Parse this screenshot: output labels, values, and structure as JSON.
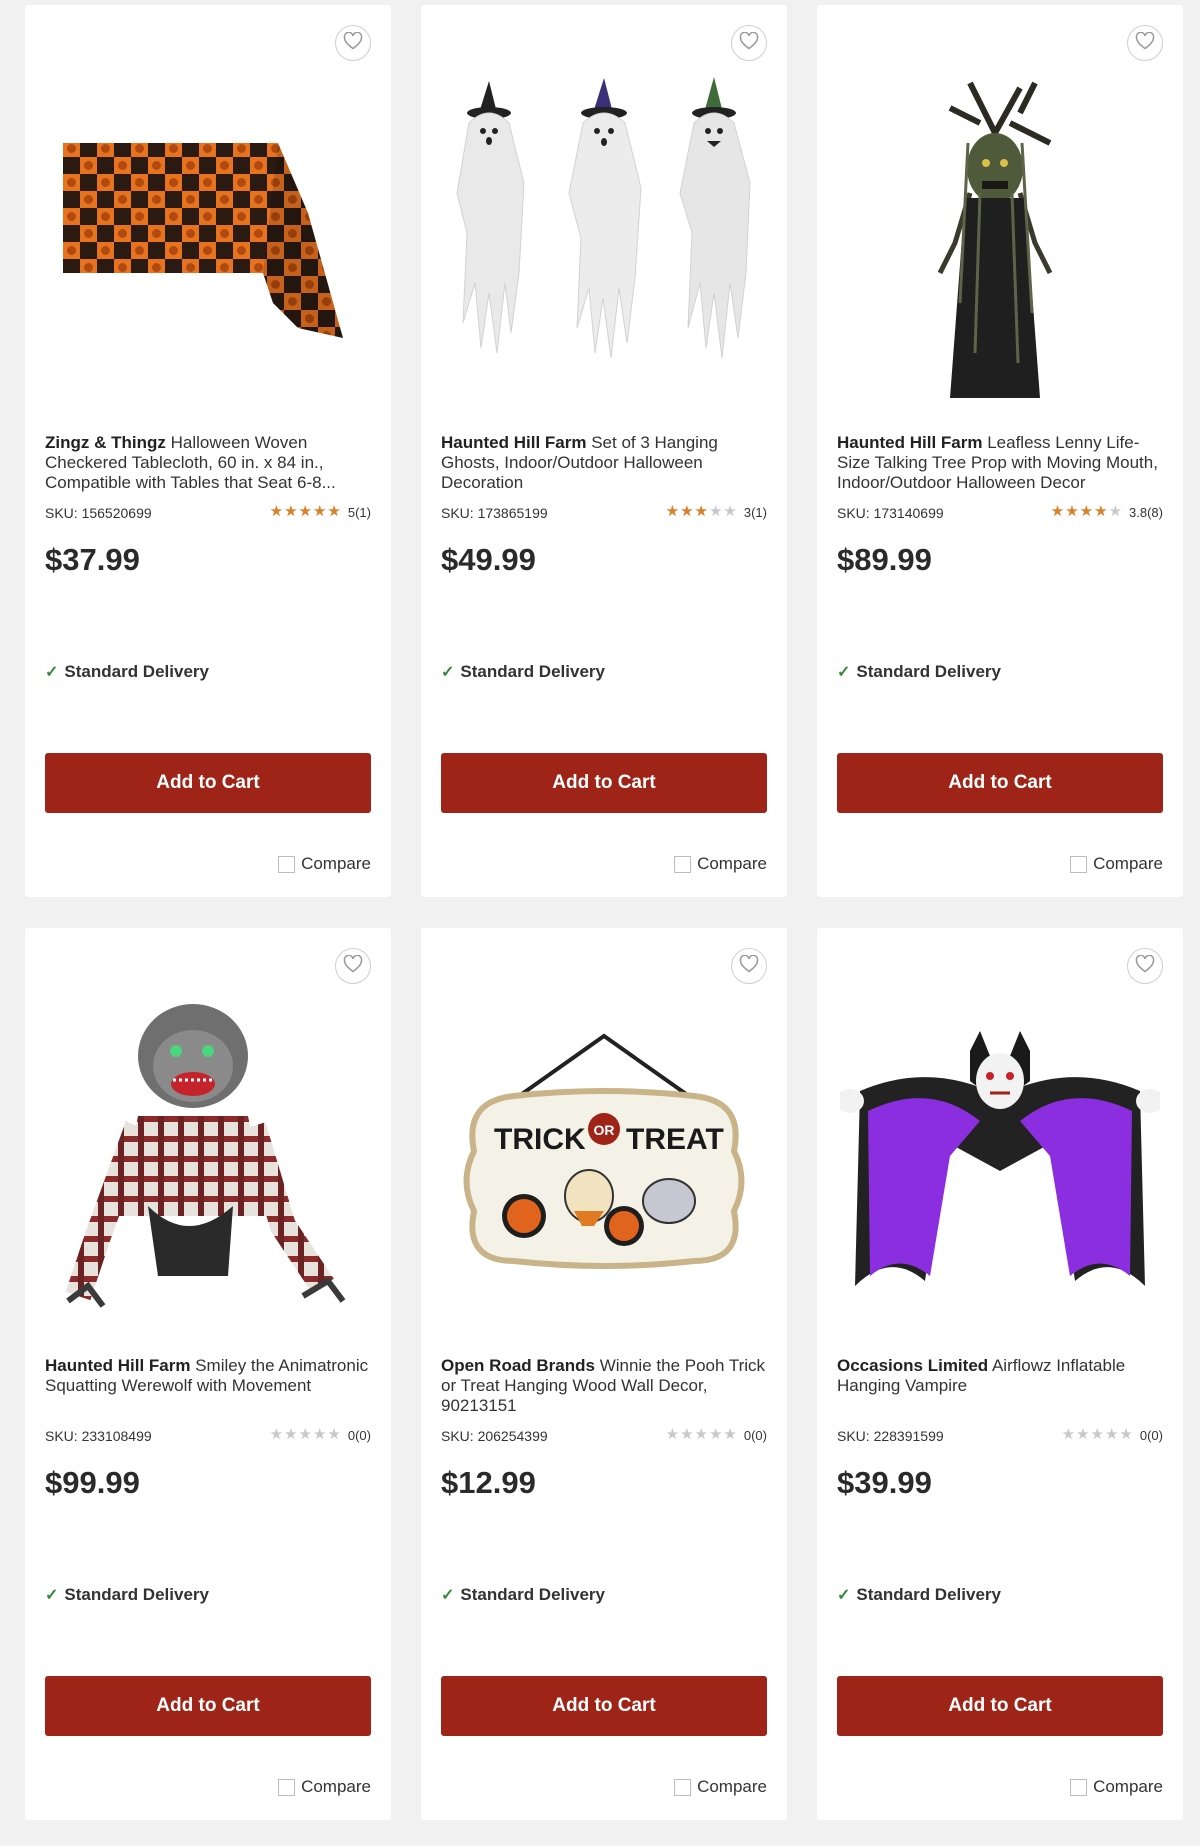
{
  "products": [
    {
      "brand": "Zingz & Thingz",
      "name": "Halloween Woven Checkered Tablecloth, 60 in. x 84 in., Compatible with Tables that Seat 6-8...",
      "sku": "SKU: 156520699",
      "rating": 5.0,
      "rating_text": "5(1)",
      "price": "$37.99",
      "delivery": "Standard Delivery",
      "cart_label": "Add to Cart",
      "compare_label": "Compare",
      "image_icon": "tablecloth-image"
    },
    {
      "brand": "Haunted Hill Farm",
      "name": "Set of 3 Hanging Ghosts, Indoor/Outdoor Halloween Decoration",
      "sku": "SKU: 173865199",
      "rating": 3.0,
      "rating_text": "3(1)",
      "price": "$49.99",
      "delivery": "Standard Delivery",
      "cart_label": "Add to Cart",
      "compare_label": "Compare",
      "image_icon": "hanging-ghosts-image"
    },
    {
      "brand": "Haunted Hill Farm",
      "name": "Leafless Lenny Life-Size Talking Tree Prop with Moving Mouth, Indoor/Outdoor Halloween Decor",
      "sku": "SKU: 173140699",
      "rating": 3.8,
      "rating_text": "3.8(8)",
      "price": "$89.99",
      "delivery": "Standard Delivery",
      "cart_label": "Add to Cart",
      "compare_label": "Compare",
      "image_icon": "tree-prop-image"
    },
    {
      "brand": "Haunted Hill Farm",
      "name": "Smiley the Animatronic Squatting Werewolf with Movement",
      "sku": "SKU: 233108499",
      "rating": 0,
      "rating_text": "0(0)",
      "price": "$99.99",
      "delivery": "Standard Delivery",
      "cart_label": "Add to Cart",
      "compare_label": "Compare",
      "image_icon": "werewolf-image"
    },
    {
      "brand": "Open Road Brands",
      "name": "Winnie the Pooh Trick or Treat Hanging Wood Wall Decor, 90213151",
      "sku": "SKU: 206254399",
      "rating": 0,
      "rating_text": "0(0)",
      "price": "$12.99",
      "delivery": "Standard Delivery",
      "cart_label": "Add to Cart",
      "compare_label": "Compare",
      "image_icon": "trick-or-treat-sign-image",
      "image_text": [
        "TRICK",
        "OR",
        "TREAT"
      ]
    },
    {
      "brand": "Occasions Limited",
      "name": "Airflowz Inflatable Hanging Vampire",
      "sku": "SKU: 228391599",
      "rating": 0,
      "rating_text": "0(0)",
      "price": "$39.99",
      "delivery": "Standard Delivery",
      "cart_label": "Add to Cart",
      "compare_label": "Compare",
      "image_icon": "vampire-inflatable-image"
    }
  ],
  "colors": {
    "cart_button": "#9e2417",
    "star_filled": "#d9822b",
    "star_empty": "#c8c8c8",
    "check": "#3a8a3a",
    "page_bg": "#f1f1f1"
  }
}
